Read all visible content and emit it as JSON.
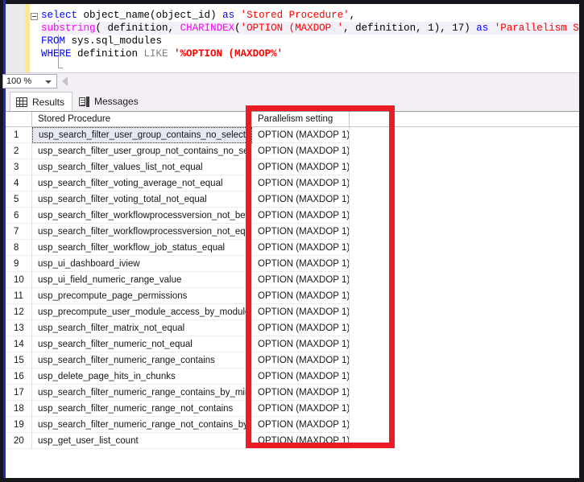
{
  "editor": {
    "gutter": {
      "collapse_icon": "collapse-minus-icon"
    },
    "lines": [
      {
        "highlight": false,
        "tokens": [
          {
            "t": "select ",
            "c": "kw"
          },
          {
            "t": "object_name",
            "c": "plain"
          },
          {
            "t": "(",
            "c": "plain"
          },
          {
            "t": "object_id",
            "c": "plain"
          },
          {
            "t": ") ",
            "c": "plain"
          },
          {
            "t": "as ",
            "c": "kw"
          },
          {
            "t": "'Stored Procedure'",
            "c": "str"
          },
          {
            "t": ",",
            "c": "plain"
          }
        ]
      },
      {
        "highlight": true,
        "tokens": [
          {
            "t": "substring",
            "c": "fn"
          },
          {
            "t": "( ",
            "c": "plain"
          },
          {
            "t": "definition",
            "c": "plain"
          },
          {
            "t": ", ",
            "c": "plain"
          },
          {
            "t": "CHARINDEX",
            "c": "fn"
          },
          {
            "t": "(",
            "c": "plain"
          },
          {
            "t": "'OPTION (MAXDOP '",
            "c": "str"
          },
          {
            "t": ", ",
            "c": "plain"
          },
          {
            "t": "definition",
            "c": "plain"
          },
          {
            "t": ", ",
            "c": "plain"
          },
          {
            "t": "1",
            "c": "plain"
          },
          {
            "t": "), ",
            "c": "plain"
          },
          {
            "t": "17",
            "c": "plain"
          },
          {
            "t": ") ",
            "c": "plain"
          },
          {
            "t": "as ",
            "c": "kw"
          },
          {
            "t": "'Parallelism Setting'",
            "c": "str"
          }
        ]
      },
      {
        "highlight": false,
        "tokens": [
          {
            "t": "FROM ",
            "c": "kw"
          },
          {
            "t": "sys.sql_modules",
            "c": "plain"
          }
        ]
      },
      {
        "highlight": false,
        "tokens": [
          {
            "t": "WHERE ",
            "c": "kw"
          },
          {
            "t": "definition ",
            "c": "plain"
          },
          {
            "t": "LIKE ",
            "c": "kw-gray"
          },
          {
            "t": "'%OPTION (MAXDOP%'",
            "c": "strb"
          }
        ]
      }
    ]
  },
  "statusbar": {
    "zoom_value": "100 %",
    "zoom_arrow_icon": "chevron-down-icon",
    "scroll_left_icon": "triangle-left-icon"
  },
  "tabs": [
    {
      "label": "Results",
      "icon": "grid-icon",
      "active": true
    },
    {
      "label": "Messages",
      "icon": "message-list-icon",
      "active": false
    }
  ],
  "grid": {
    "columns": [
      {
        "key": "rownum",
        "label": ""
      },
      {
        "key": "procedure",
        "label": "Stored Procedure"
      },
      {
        "key": "parallelism",
        "label": "Parallelism setting"
      }
    ],
    "focused_cell": {
      "row": 1,
      "column": "procedure"
    },
    "rows": [
      {
        "n": "1",
        "procedure": "usp_search_filter_user_group_contains_no_selection",
        "parallelism": "OPTION (MAXDOP 1)"
      },
      {
        "n": "2",
        "procedure": "usp_search_filter_user_group_not_contains_no_sel...",
        "parallelism": "OPTION (MAXDOP 1)"
      },
      {
        "n": "3",
        "procedure": "usp_search_filter_values_list_not_equal",
        "parallelism": "OPTION (MAXDOP 1)"
      },
      {
        "n": "4",
        "procedure": "usp_search_filter_voting_average_not_equal",
        "parallelism": "OPTION (MAXDOP 1)"
      },
      {
        "n": "5",
        "procedure": "usp_search_filter_voting_total_not_equal",
        "parallelism": "OPTION (MAXDOP 1)"
      },
      {
        "n": "6",
        "procedure": "usp_search_filter_workflowprocessversion_not_bet...",
        "parallelism": "OPTION (MAXDOP 1)"
      },
      {
        "n": "7",
        "procedure": "usp_search_filter_workflowprocessversion_not_equal",
        "parallelism": "OPTION (MAXDOP 1)"
      },
      {
        "n": "8",
        "procedure": "usp_search_filter_workflow_job_status_equal",
        "parallelism": "OPTION (MAXDOP 1)"
      },
      {
        "n": "9",
        "procedure": "usp_ui_dashboard_iview",
        "parallelism": "OPTION (MAXDOP 1)"
      },
      {
        "n": "10",
        "procedure": "usp_ui_field_numeric_range_value",
        "parallelism": "OPTION (MAXDOP 1)"
      },
      {
        "n": "11",
        "procedure": "usp_precompute_page_permissions",
        "parallelism": "OPTION (MAXDOP 1)"
      },
      {
        "n": "12",
        "procedure": "usp_precompute_user_module_access_by_module",
        "parallelism": "OPTION (MAXDOP 1)"
      },
      {
        "n": "13",
        "procedure": "usp_search_filter_matrix_not_equal",
        "parallelism": "OPTION (MAXDOP 1)"
      },
      {
        "n": "14",
        "procedure": "usp_search_filter_numeric_not_equal",
        "parallelism": "OPTION (MAXDOP 1)"
      },
      {
        "n": "15",
        "procedure": "usp_search_filter_numeric_range_contains",
        "parallelism": "OPTION (MAXDOP 1)"
      },
      {
        "n": "16",
        "procedure": "usp_delete_page_hits_in_chunks",
        "parallelism": "OPTION (MAXDOP 1)"
      },
      {
        "n": "17",
        "procedure": "usp_search_filter_numeric_range_contains_by_min_...",
        "parallelism": "OPTION (MAXDOP 1)"
      },
      {
        "n": "18",
        "procedure": "usp_search_filter_numeric_range_not_contains",
        "parallelism": "OPTION (MAXDOP 1)"
      },
      {
        "n": "19",
        "procedure": "usp_search_filter_numeric_range_not_contains_by_...",
        "parallelism": "OPTION (MAXDOP 1)"
      },
      {
        "n": "20",
        "procedure": "usp_get_user_list_count",
        "parallelism": "OPTION (MAXDOP 1)"
      }
    ]
  },
  "annotation": {
    "name": "red-highlight-box",
    "color": "#ec1c24"
  }
}
